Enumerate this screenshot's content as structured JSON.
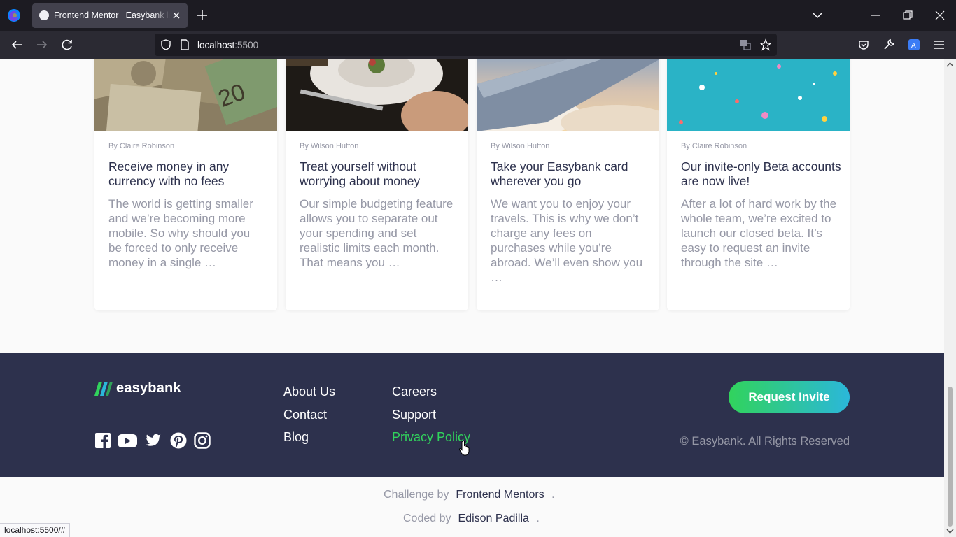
{
  "browser": {
    "tab_title": "Frontend Mentor | Easybank landing page",
    "url_host": "localhost",
    "url_port": ":5500",
    "status_url": "localhost:5500/#"
  },
  "articles": [
    {
      "author": "By Claire Robinson",
      "title": "Receive money in any currency with no fees",
      "excerpt": "The world is getting smaller and we’re becoming more mobile. So why should you be forced to only receive money in a single …",
      "image": "currency-banknotes"
    },
    {
      "author": "By Wilson Hutton",
      "title": "Treat yourself without worrying about money",
      "excerpt": "Our simple budgeting feature allows you to separate out your spending and set realistic limits each month. That means you …",
      "image": "restaurant-plate"
    },
    {
      "author": "By Wilson Hutton",
      "title": "Take your Easybank card wherever you go",
      "excerpt": "We want you to enjoy your travels. This is why we don’t charge any fees on purchases while you’re abroad. We’ll even show you …",
      "image": "plane-wing-clouds"
    },
    {
      "author": "By Claire Robinson",
      "title": "Our invite-only Beta accounts are now live!",
      "excerpt": "After a lot of hard work by the whole team, we’re excited to launch our closed beta. It’s easy to request an invite through the site …",
      "image": "confetti"
    }
  ],
  "footer": {
    "logo_text": "easybank",
    "links": [
      "About Us",
      "Contact",
      "Blog",
      "Careers",
      "Support",
      "Privacy Policy"
    ],
    "cta": "Request Invite",
    "copyright": "© Easybank. All Rights Reserved",
    "social_icons": [
      "facebook-icon",
      "youtube-icon",
      "twitter-icon",
      "pinterest-icon",
      "instagram-icon"
    ]
  },
  "attribution": {
    "challenge_label": "Challenge by",
    "challenge_link": "Frontend Mentors",
    "coded_label": "Coded by",
    "coded_link": "Edison Padilla",
    "period": "."
  },
  "colors": {
    "dark_blue": "#2d314d",
    "lime_green": "#31d35c",
    "bright_cyan": "#2bb7da",
    "grayish_blue": "#9698a6"
  }
}
